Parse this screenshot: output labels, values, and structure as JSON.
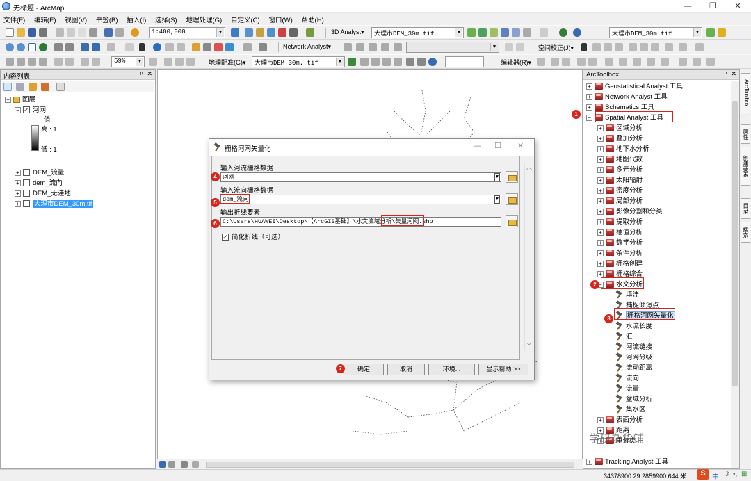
{
  "window": {
    "title": "无标题 - ArcMap",
    "min": "—",
    "restore": "❐",
    "close": "✕"
  },
  "menu": [
    "文件(F)",
    "编辑(E)",
    "视图(V)",
    "书签(B)",
    "插入(I)",
    "选择(S)",
    "地理处理(G)",
    "自定义(C)",
    "窗口(W)",
    "帮助(H)"
  ],
  "toolbar1": {
    "scale": "1:400,000",
    "analyst3d": "3D Analyst▾",
    "layer_combo1": "大理市DEM_30m.tif",
    "layer_combo2": "大理市DEM_30m.tif"
  },
  "toolbar2": {
    "zoom": "59%",
    "network_analyst": "Network Analyst▾",
    "spatial_correction": "空间校正(J)▾"
  },
  "toolbar3": {
    "georef": "地理配准(G)▾",
    "georef_layer": "大理市DEM_30m. tif",
    "editor": "编辑器(R)▾"
  },
  "toc": {
    "title": "内容列表",
    "pin": "📌",
    "close": "✕",
    "layers_group": "图层",
    "items": [
      {
        "name": "河网",
        "checked": true
      },
      {
        "name": "DEM_流量",
        "checked": false
      },
      {
        "name": "dem_流向",
        "checked": false
      },
      {
        "name": "DEM_无洼地",
        "checked": false
      },
      {
        "name": "大理市DEM_30m.tif",
        "checked": false
      }
    ],
    "legend_value": "值",
    "legend_high": "高 : 1",
    "legend_low": "低 : 1"
  },
  "arctoolbox": {
    "title": "ArcToolbox",
    "top_items": [
      "Geostatistical Analyst 工具",
      "Network Analyst 工具",
      "Schematics 工具",
      "Spatial Analyst 工具"
    ],
    "spatial_children": [
      "区域分析",
      "叠加分析",
      "地下水分析",
      "地图代数",
      "多元分析",
      "太阳辐射",
      "密度分析",
      "局部分析",
      "影像分割和分类",
      "提取分析",
      "插值分析",
      "数学分析",
      "条件分析",
      "栅格创建",
      "栅格综合",
      "水文分析"
    ],
    "hydro_tools": [
      "填洼",
      "捕捉倾泻点",
      "栅格河网矢量化",
      "水流长度",
      "汇",
      "河流链接",
      "河网分级",
      "流动距离",
      "流向",
      "流量",
      "盆域分析",
      "集水区"
    ],
    "after_items": [
      "表面分析",
      "距离",
      "重分类"
    ],
    "last_item": "Tracking Analyst 工具"
  },
  "right_tabs": [
    "ArcToolbox",
    "属性",
    "创建要素",
    "目录",
    "搜索"
  ],
  "dialog": {
    "title": "栅格河网矢量化",
    "label_stream": "输入河流栅格数据",
    "value_stream": "河网",
    "label_flowdir": "输入流向栅格数据",
    "value_flowdir": "dem_流向",
    "label_output": "输出折线要素",
    "value_output": "C:\\Users\\HUAWEI\\Desktop\\【ArcGIS基础】\\水文流域分析\\矢量河网.shp",
    "simplify_label": "简化折线（可选）",
    "simplify_checked": true,
    "btn_ok": "确定",
    "btn_cancel": "取消",
    "btn_env": "环境...",
    "btn_help": "显示帮助 >>"
  },
  "badges": [
    "1",
    "2",
    "3",
    "4",
    "5",
    "6",
    "7"
  ],
  "status": {
    "coords": "34378900.29  2859900.644 米"
  },
  "watermark": "学研杂货铺",
  "ime": "中"
}
